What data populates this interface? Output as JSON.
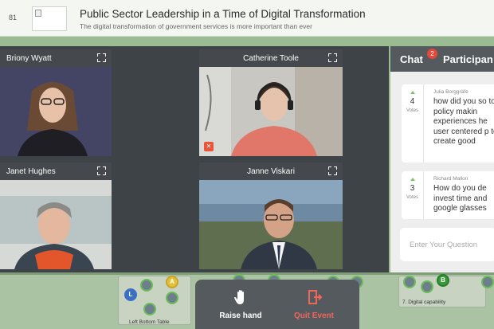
{
  "header": {
    "page_number": "81",
    "title": "Public Sector Leadership in a Time of Digital Transformation",
    "subtitle": "The digital transformation of government services is more important than ever"
  },
  "participants": [
    {
      "name": "Briony Wyatt"
    },
    {
      "name": "Catherine Toole"
    },
    {
      "name": "Janet Hughes"
    },
    {
      "name": "Janne Viskari"
    }
  ],
  "chat": {
    "tab_chat": "Chat",
    "unread_count": "2",
    "tab_participants": "Participan",
    "questions": [
      {
        "author": "Julia Borggräfe",
        "votes": "4",
        "votes_label": "Votes",
        "text": "how did you so to policy makin experiences he user centered p to create good"
      },
      {
        "author": "Richard Mallon",
        "votes": "3",
        "votes_label": "Votes",
        "text": "How do you de invest time and google glasses"
      }
    ],
    "input_placeholder": "Enter Your Question"
  },
  "controls": {
    "raise_hand": "Raise hand",
    "quit_event": "Quit Event"
  },
  "map": {
    "left_table_label": "Left Bottom Table",
    "right_table_label": "7. Digital capability",
    "avatar_letters": {
      "l": "L",
      "a": "A",
      "b": "B"
    }
  },
  "colors": {
    "accent_red": "#e2493b",
    "quit_red": "#f0665a",
    "vote_green": "#7cc26a",
    "panel_dark": "#555a5e"
  }
}
